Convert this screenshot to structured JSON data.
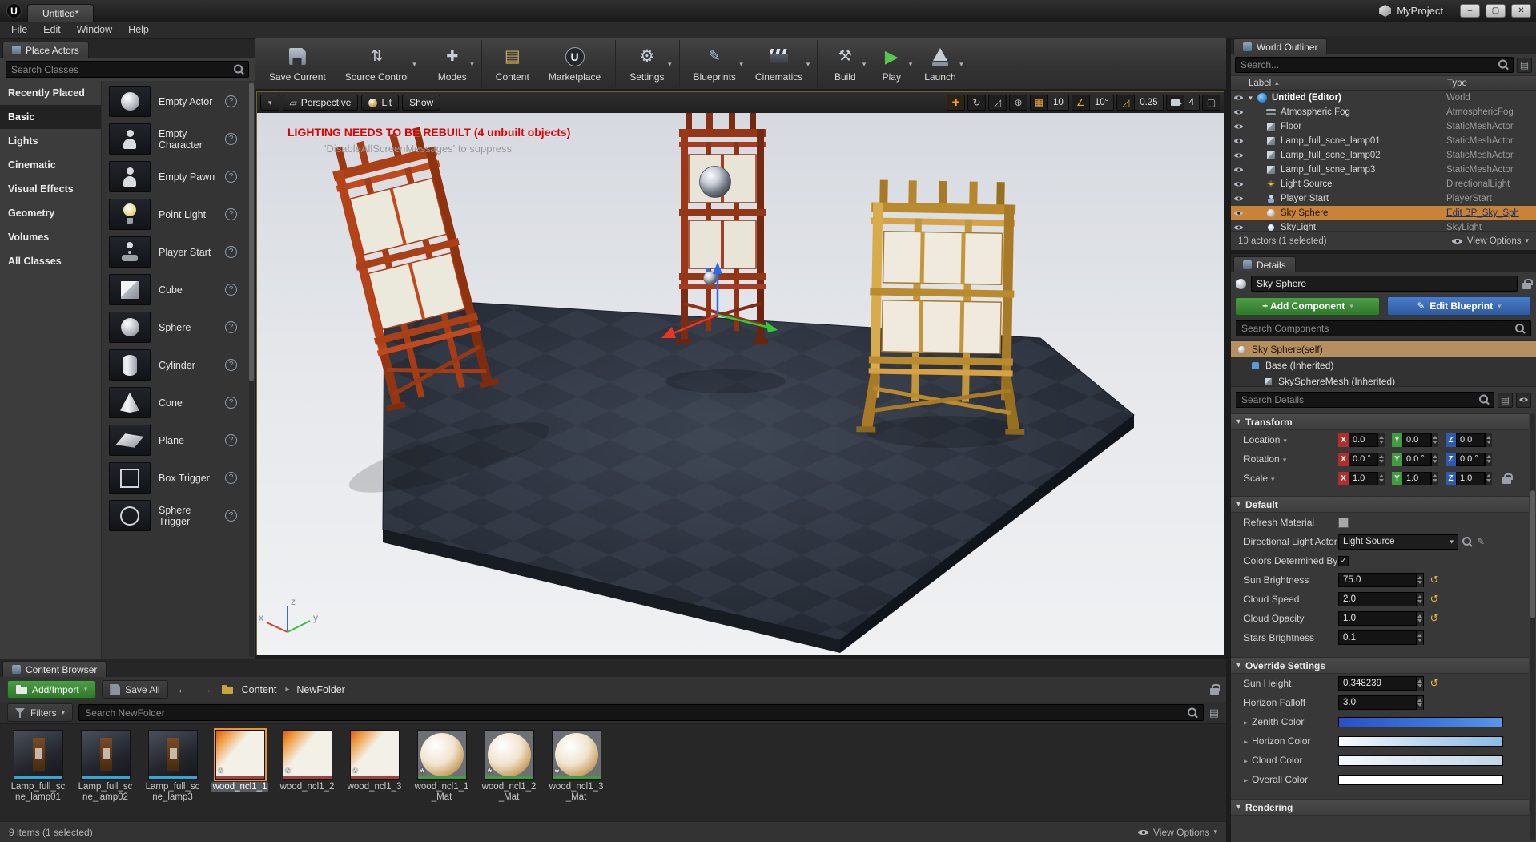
{
  "window": {
    "logo": "U",
    "tab_title": "Untitled*",
    "project_name": "MyProject",
    "controls": {
      "minimize": "–",
      "maximize": "▢",
      "close": "✕"
    }
  },
  "menubar": {
    "items": [
      {
        "label": "File"
      },
      {
        "label": "Edit"
      },
      {
        "label": "Window"
      },
      {
        "label": "Help"
      }
    ]
  },
  "place_actors": {
    "tab": "Place Actors",
    "search_placeholder": "Search Classes",
    "categories": [
      {
        "label": "Recently Placed"
      },
      {
        "label": "Basic",
        "selected": true
      },
      {
        "label": "Lights"
      },
      {
        "label": "Cinematic"
      },
      {
        "label": "Visual Effects"
      },
      {
        "label": "Geometry"
      },
      {
        "label": "Volumes"
      },
      {
        "label": "All Classes"
      }
    ],
    "items": [
      {
        "label": "Empty Actor",
        "icon": "empty-actor",
        "help": "?"
      },
      {
        "label": "Empty Character",
        "icon": "empty-character",
        "help": "?"
      },
      {
        "label": "Empty Pawn",
        "icon": "empty-pawn",
        "help": "?"
      },
      {
        "label": "Point Light",
        "icon": "point-light",
        "help": "?"
      },
      {
        "label": "Player Start",
        "icon": "player-start",
        "help": "?"
      },
      {
        "label": "Cube",
        "icon": "cube",
        "help": "?"
      },
      {
        "label": "Sphere",
        "icon": "sphere",
        "help": "?"
      },
      {
        "label": "Cylinder",
        "icon": "cylinder",
        "help": "?"
      },
      {
        "label": "Cone",
        "icon": "cone",
        "help": "?"
      },
      {
        "label": "Plane",
        "icon": "plane",
        "help": "?"
      },
      {
        "label": "Box Trigger",
        "icon": "box-trigger",
        "help": "?"
      },
      {
        "label": "Sphere Trigger",
        "icon": "sphere-trigger",
        "help": "?"
      }
    ]
  },
  "toolbar": {
    "buttons": [
      {
        "label": "Save Current",
        "icon": "save"
      },
      {
        "label": "Source Control",
        "icon": "source-control",
        "caret": true
      },
      {
        "label": "Modes",
        "icon": "modes",
        "caret": true,
        "sep": true
      },
      {
        "label": "Content",
        "icon": "content",
        "sep": true
      },
      {
        "label": "Marketplace",
        "icon": "marketplace"
      },
      {
        "label": "Settings",
        "icon": "settings",
        "caret": true,
        "sep": true
      },
      {
        "label": "Blueprints",
        "icon": "blueprints",
        "caret": true,
        "sep": true
      },
      {
        "label": "Cinematics",
        "icon": "cinematics",
        "caret": true
      },
      {
        "label": "Build",
        "icon": "build",
        "caret": true,
        "sep": true
      },
      {
        "label": "Play",
        "icon": "play",
        "caret": true
      },
      {
        "label": "Launch",
        "icon": "launch",
        "caret": true
      }
    ]
  },
  "viewport": {
    "perspective_label": "Perspective",
    "lit_label": "Lit",
    "show_label": "Show",
    "snap_grid": "10",
    "snap_angle": "10°",
    "snap_scale": "0.25",
    "camera_speed": "4",
    "warning_title": "LIGHTING NEEDS TO BE REBUILT (4 unbuilt objects)",
    "warning_sub": "'DisableAllScreenMessages' to suppress",
    "axis": {
      "x": "x",
      "y": "y",
      "z": "z"
    }
  },
  "outliner": {
    "tab": "World Outliner",
    "search_placeholder": "Search...",
    "columns": {
      "label": "Label",
      "type": "Type"
    },
    "rows": [
      {
        "label": "Untitled (Editor)",
        "type": "World",
        "icon": "world",
        "root": true
      },
      {
        "label": "Atmospheric Fog",
        "type": "AtmosphericFog",
        "icon": "fog"
      },
      {
        "label": "Floor",
        "type": "StaticMeshActor",
        "icon": "mesh"
      },
      {
        "label": "Lamp_full_scne_lamp01",
        "type": "StaticMeshActor",
        "icon": "mesh"
      },
      {
        "label": "Lamp_full_scne_lamp02",
        "type": "StaticMeshActor",
        "icon": "mesh"
      },
      {
        "label": "Lamp_full_scne_lamp3",
        "type": "StaticMeshActor",
        "icon": "mesh"
      },
      {
        "label": "Light Source",
        "type": "DirectionalLight",
        "icon": "light"
      },
      {
        "label": "Player Start",
        "type": "PlayerStart",
        "icon": "player"
      },
      {
        "label": "Sky Sphere",
        "type": "Edit BP_Sky_Sph",
        "icon": "sphere",
        "selected": true,
        "link": true
      },
      {
        "label": "SkyLight",
        "type": "SkyLight",
        "icon": "skylight"
      }
    ],
    "status": "10 actors (1 selected)",
    "view_options": "View Options"
  },
  "details": {
    "tab": "Details",
    "name_value": "Sky Sphere",
    "add_component": "+ Add Component",
    "edit_blueprint": "Edit Blueprint",
    "search_components_placeholder": "Search Components",
    "components": [
      {
        "label": "Sky Sphere(self)",
        "icon": "sphere",
        "selected": true
      },
      {
        "label": "Base (Inherited)",
        "icon": "base",
        "indent_class": "ind1"
      },
      {
        "label": "SkySphereMesh (Inherited)",
        "icon": "mesh",
        "indent_class": "ind2"
      }
    ],
    "search_details_placeholder": "Search Details",
    "transform": {
      "title": "Transform",
      "axis_letters": {
        "x": "X",
        "y": "Y",
        "z": "Z"
      },
      "rows": [
        {
          "label": "Location",
          "x": "0.0",
          "y": "0.0",
          "z": "0.0"
        },
        {
          "label": "Rotation",
          "x": "0.0 °",
          "y": "0.0 °",
          "z": "0.0 °"
        },
        {
          "label": "Scale",
          "x": "1.0",
          "y": "1.0",
          "z": "1.0",
          "lock": true
        }
      ]
    },
    "default_section": {
      "title": "Default",
      "refresh_material_label": "Refresh Material",
      "directional_light_label": "Directional Light Actor",
      "directional_light_value": "Light Source",
      "colors_determined_label": "Colors Determined By",
      "numeric_rows": [
        {
          "label": "Sun Brightness",
          "value": "75.0",
          "reset": true
        },
        {
          "label": "Cloud Speed",
          "value": "2.0",
          "reset": true
        },
        {
          "label": "Cloud Opacity",
          "value": "1.0",
          "reset": true
        },
        {
          "label": "Stars Brightness",
          "value": "0.1"
        }
      ]
    },
    "override_section": {
      "title": "Override Settings",
      "numeric_rows": [
        {
          "label": "Sun Height",
          "value": "0.348239",
          "reset": true
        },
        {
          "label": "Horizon Falloff",
          "value": "3.0"
        }
      ],
      "color_rows": [
        {
          "label": "Zenith Color",
          "gradient": "zenith"
        },
        {
          "label": "Horizon Color",
          "gradient": "horizon"
        },
        {
          "label": "Cloud Color",
          "gradient": "cloud"
        },
        {
          "label": "Overall Color",
          "gradient": "overall"
        }
      ]
    },
    "rendering_title": "Rendering"
  },
  "content_browser": {
    "tab": "Content Browser",
    "add_import": "Add/Import",
    "save_all": "Save All",
    "path": [
      {
        "label": "Content"
      },
      {
        "label": "NewFolder"
      }
    ],
    "filters": "Filters",
    "search_placeholder": "Search NewFolder",
    "assets": [
      {
        "name": "Lamp_full_scne_lamp01",
        "kind": "lamp-mesh"
      },
      {
        "name": "Lamp_full_scne_lamp02",
        "kind": "lamp-mesh"
      },
      {
        "name": "Lamp_full_scne_lamp3",
        "kind": "lamp-mesh"
      },
      {
        "name": "wood_ncl1_1",
        "kind": "wood-texture",
        "selected": true,
        "dirty": true
      },
      {
        "name": "wood_ncl1_2",
        "kind": "wood-texture",
        "dirty": true
      },
      {
        "name": "wood_ncl1_3",
        "kind": "wood-texture",
        "dirty": true
      },
      {
        "name": "wood_ncl1_1_Mat",
        "kind": "material-sphere",
        "dirty": true
      },
      {
        "name": "wood_ncl1_2_Mat",
        "kind": "material-sphere",
        "dirty": true
      },
      {
        "name": "wood_ncl1_3_Mat",
        "kind": "material-sphere",
        "dirty": true
      }
    ],
    "status": "9 items (1 selected)",
    "view_options": "View Options"
  }
}
